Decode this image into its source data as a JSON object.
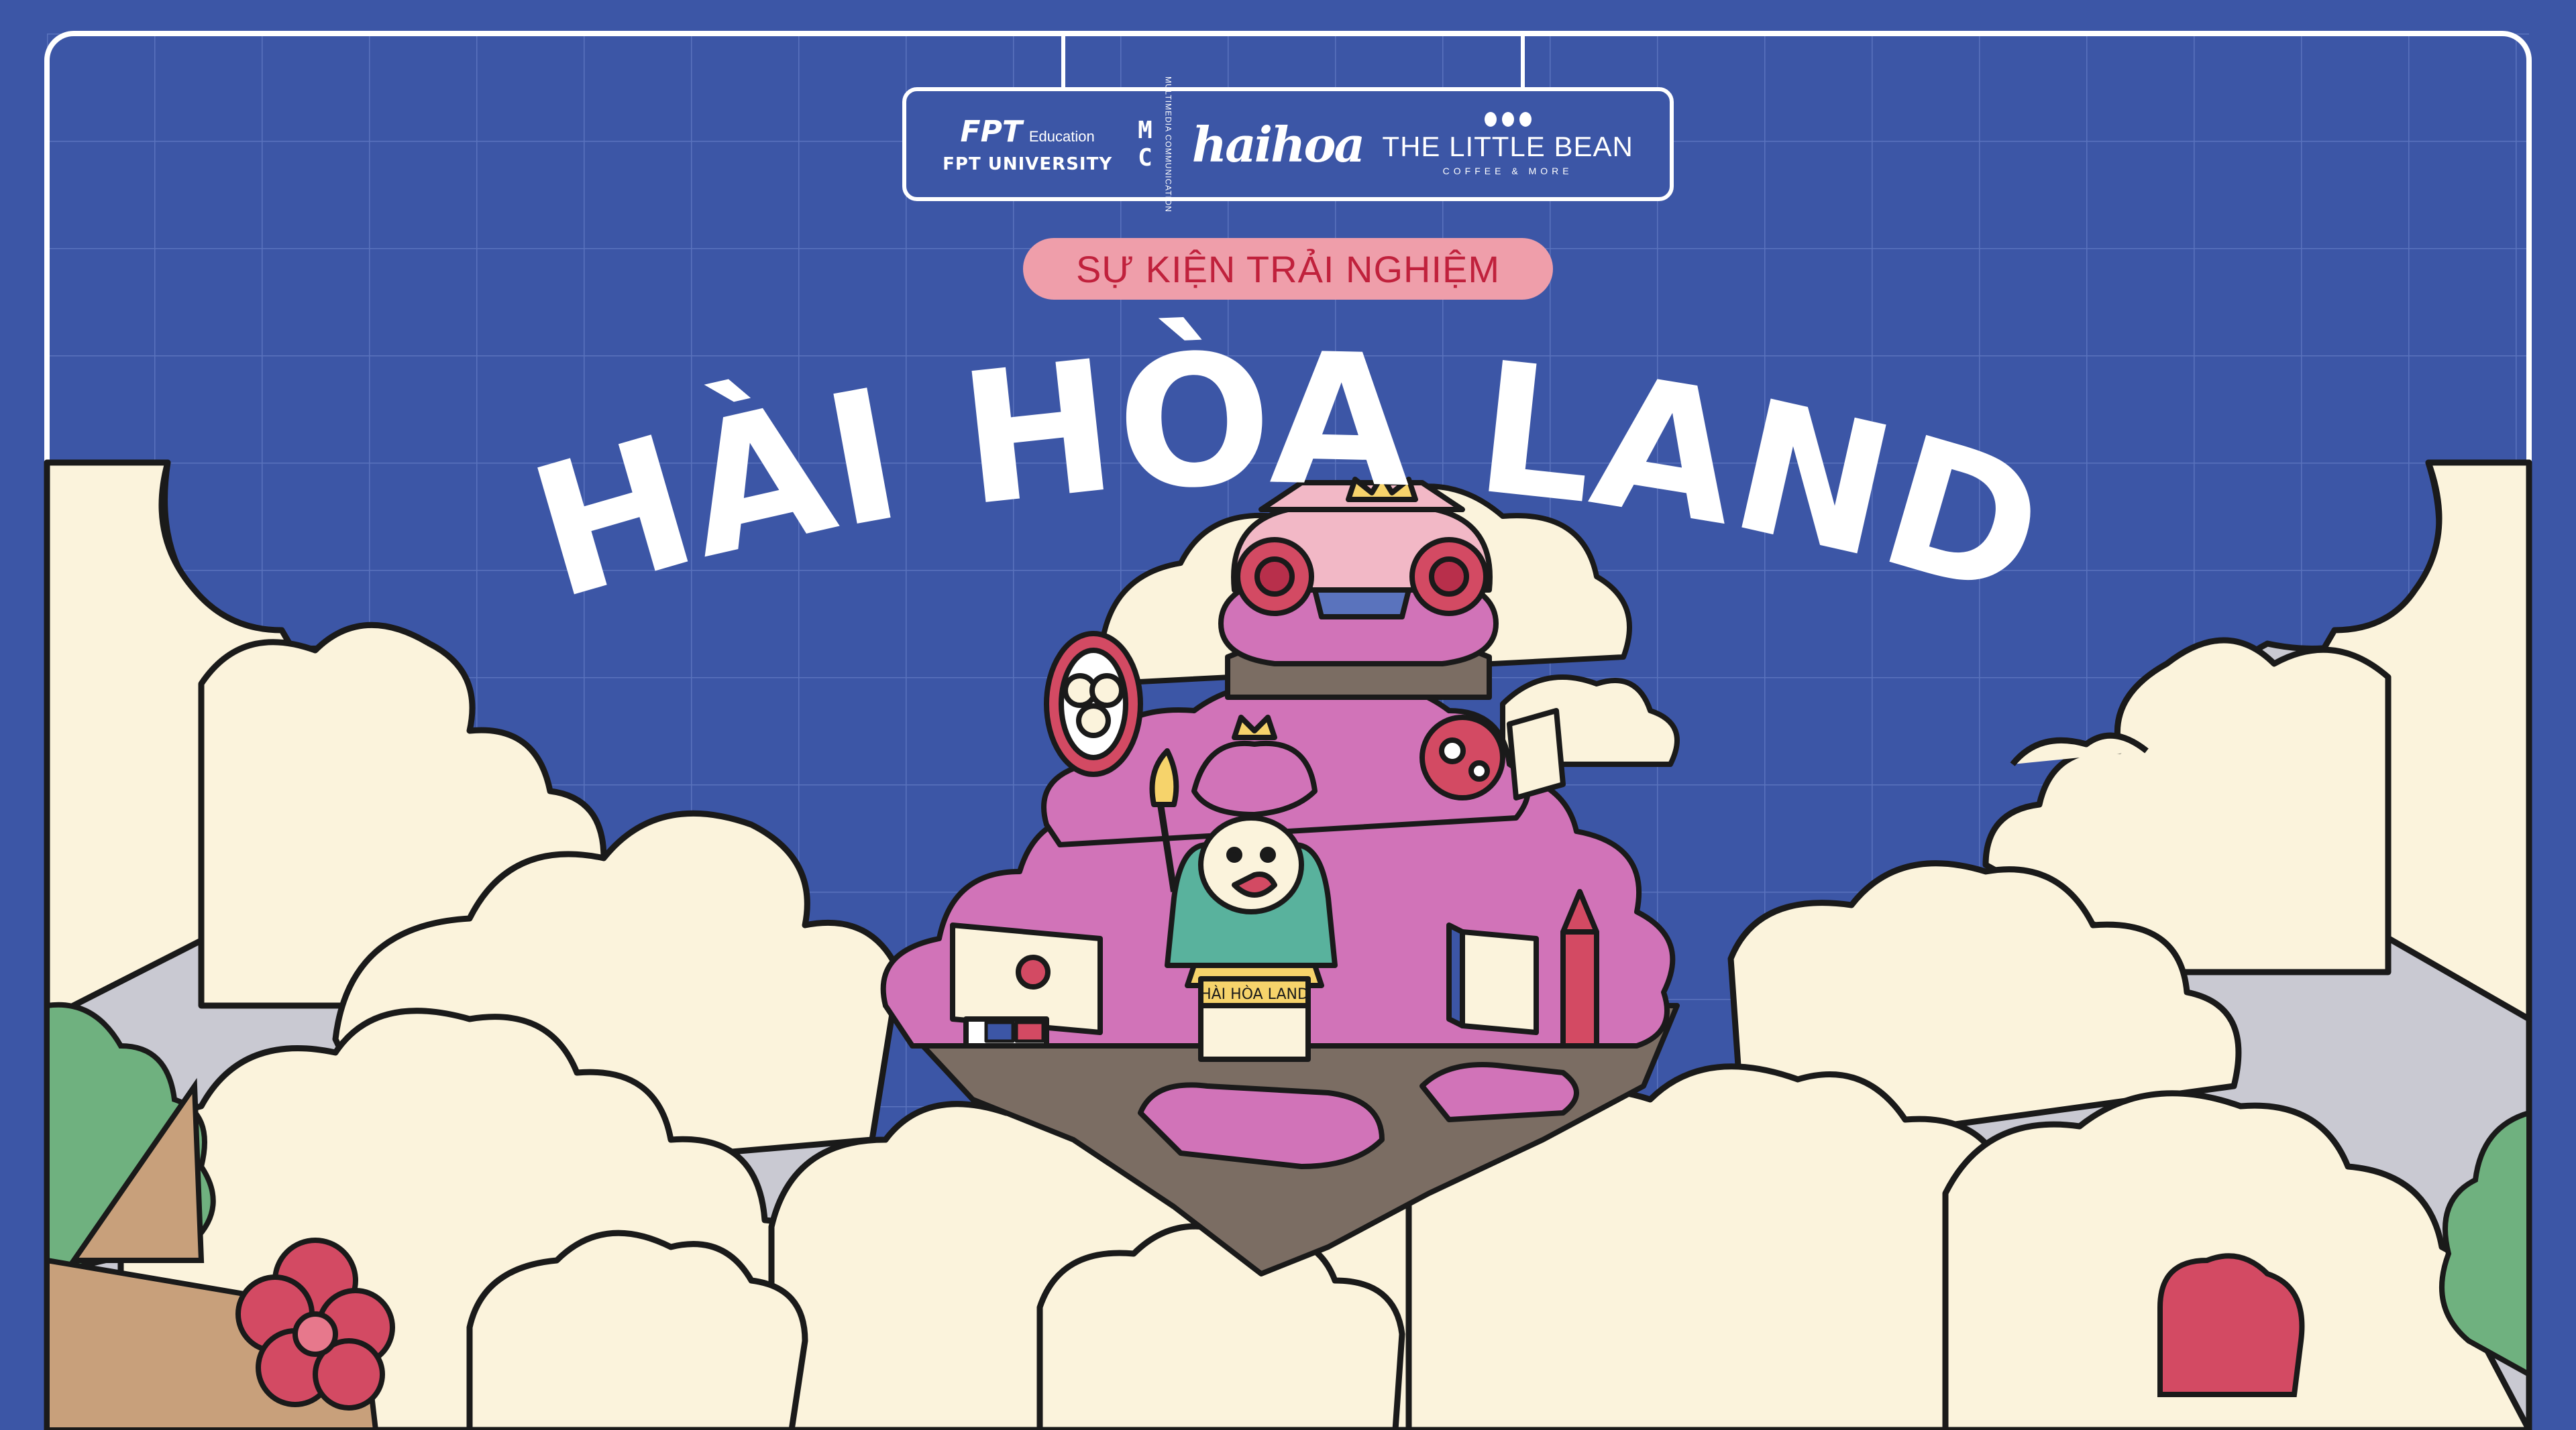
{
  "event": {
    "tag": "SỰ KIỆN TRẢI NGHIỆM",
    "title": "HÀI HÒA LAND"
  },
  "sponsors": {
    "fpt": {
      "mark": "FPT",
      "sub": "Education",
      "name": "FPT UNIVERSITY"
    },
    "mc": {
      "mark": "MC",
      "text": "MULTIMEDIA COMMUNICATION"
    },
    "haihoa": {
      "name": "haihoa"
    },
    "bean": {
      "name": "THE LITTLE BEAN",
      "sub": "COFFEE & MORE"
    }
  },
  "sign_text": "HÀI HÒA LAND",
  "colors": {
    "background": "#3c56a6",
    "grid": "#5a73bd",
    "frame": "#ffffff",
    "cloud": "#fbf3dc",
    "cloud_shadow": "#c9c9d2",
    "island_pink": "#d173b8",
    "accent_red": "#d34a63",
    "pill_bg": "#ef9eaa",
    "pill_text": "#c0213c",
    "mascot_teal": "#59b29d",
    "bush_green": "#6fb17f",
    "ink": "#1a1a1a"
  },
  "icons": [
    "fpt-logo-icon",
    "mc-logo-icon",
    "haihoa-logo-icon",
    "little-bean-logo-icon",
    "flower-icon",
    "mascot-icon"
  ]
}
